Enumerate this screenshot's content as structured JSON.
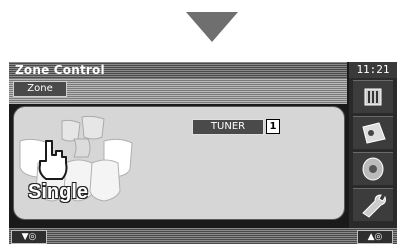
{
  "header": {
    "title": "Zone Control",
    "clock": "11:21"
  },
  "toolbar": {
    "zone_label": "Zone"
  },
  "main": {
    "source_label": "TUNER",
    "callout": "1",
    "mode_label": "Single"
  },
  "side_buttons": [
    "graphic-eq-icon",
    "car-position-icon",
    "speaker-icon",
    "wrench-icon"
  ],
  "bottom": {
    "vol_down": "▼◎",
    "vol_up": "▲◎"
  }
}
